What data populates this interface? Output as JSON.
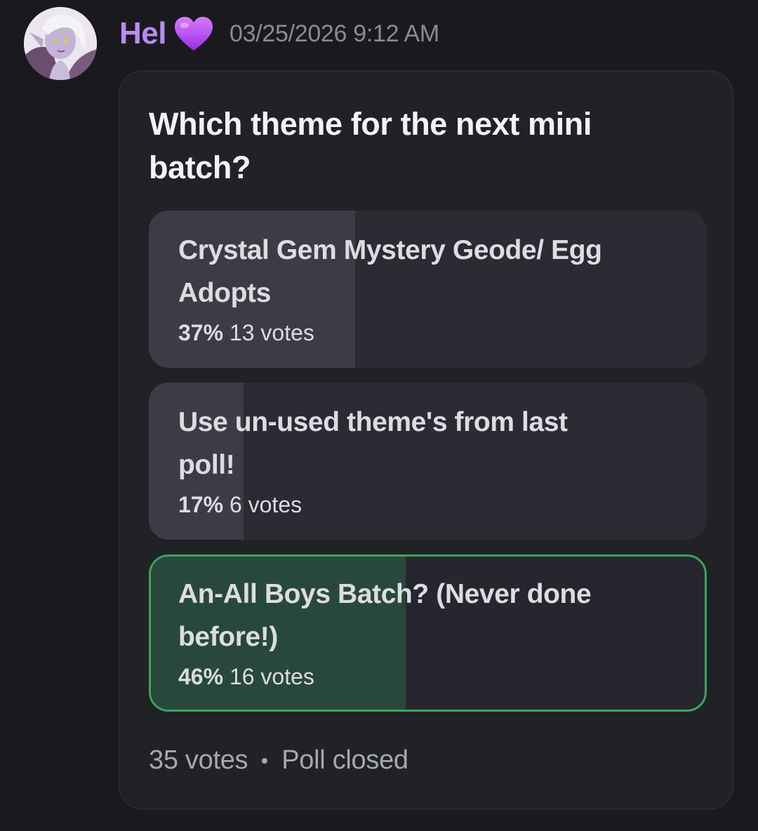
{
  "message": {
    "author": {
      "name": "Hel",
      "name_color": "#b68cf0",
      "badge_icon": "purple-heart-icon"
    },
    "timestamp": "03/25/2026 9:12 AM"
  },
  "poll": {
    "question": "Which theme for the next mini batch?",
    "options": [
      {
        "label": "Crystal Gem Mystery Geode/ Egg Adopts",
        "percent_label": "37%",
        "votes_label": "13 votes",
        "percent": 37,
        "winner": false
      },
      {
        "label": "Use un-used theme's from last poll!",
        "percent_label": "17%",
        "votes_label": "6 votes",
        "percent": 17,
        "winner": false
      },
      {
        "label": "An-All Boys Batch? (Never done before!)",
        "percent_label": "46%",
        "votes_label": "16 votes",
        "percent": 46,
        "winner": true
      }
    ],
    "total_votes": "35 votes",
    "status": "Poll closed",
    "colors": {
      "winner_border": "#3ba55c",
      "winner_fill": "#29483c",
      "option_fill": "#3c3c46"
    }
  }
}
